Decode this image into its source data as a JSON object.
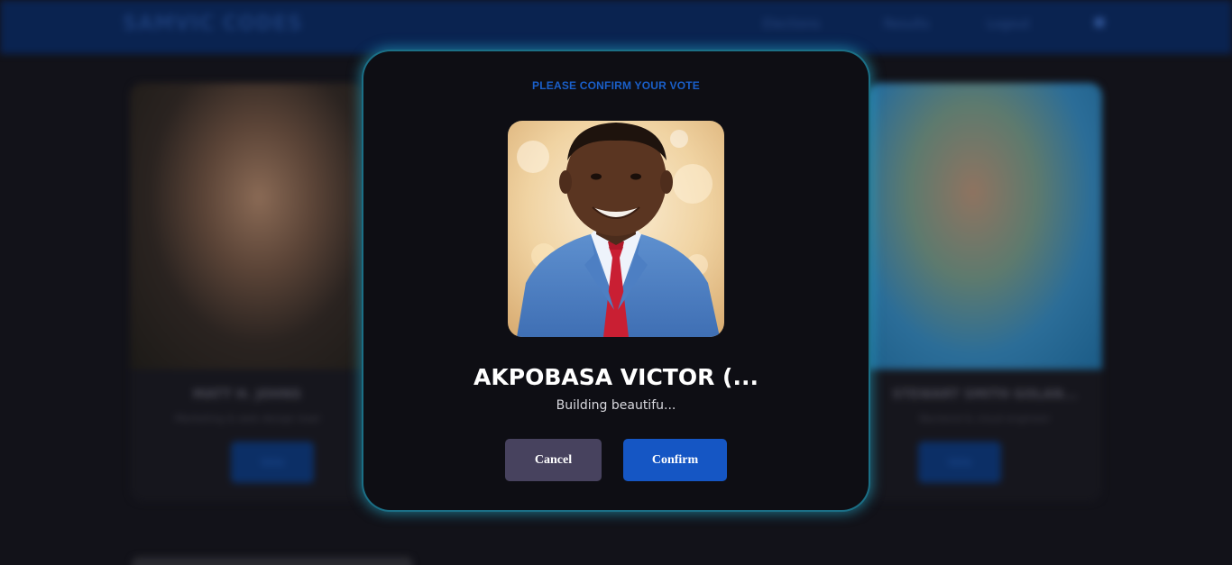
{
  "background": {
    "brand": "SAMVIC CODES",
    "nav_links": [
      "Elections",
      "Results",
      "Logout"
    ],
    "nav_icon": "user-icon",
    "cards": [
      {
        "name": "MATT H. JOHNS",
        "desc": "Marketing & web design lead",
        "vote_label": "Vote"
      },
      {
        "name": "STEWART SMITH GOLAN...",
        "desc": "Backend & cloud engineer",
        "vote_label": "Vote"
      }
    ]
  },
  "modal": {
    "heading": "PLEASE CONFIRM YOUR VOTE",
    "candidate_name": "AKPOBASA VICTOR (...",
    "candidate_bio": "Building beautifu...",
    "cancel_label": "Cancel",
    "confirm_label": "Confirm"
  },
  "colors": {
    "accent": "#1556c4",
    "cancel": "#47425e",
    "glow": "#26b4d7",
    "modal_bg": "#0e0e14"
  }
}
